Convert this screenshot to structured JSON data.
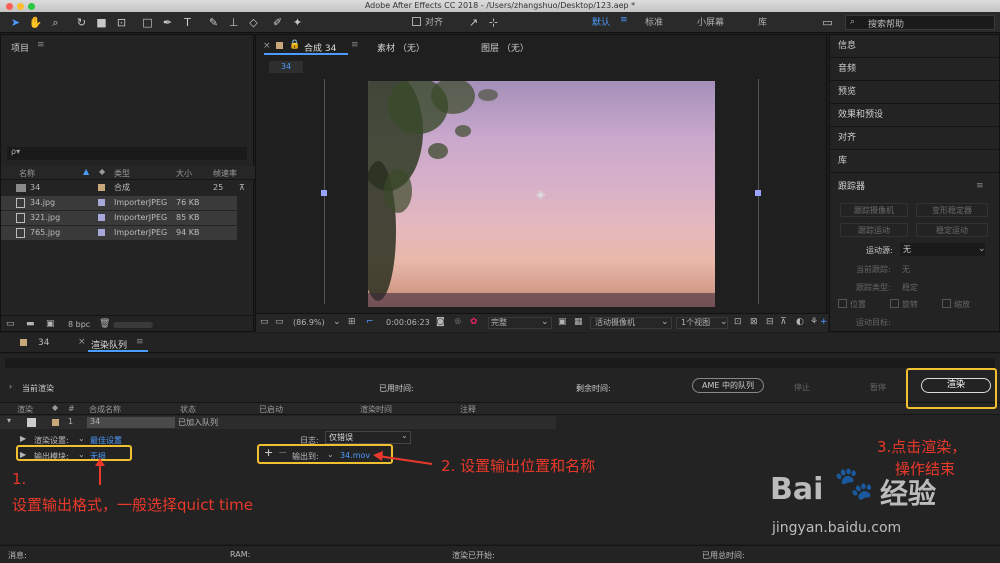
{
  "app": {
    "title": "Adobe After Effects CC 2018 - /Users/zhangshuo/Desktop/123.aep *"
  },
  "toolbar": {
    "align_label": "对齐",
    "workspaces": [
      "默认",
      "标准",
      "小屏幕",
      "库"
    ],
    "search_placeholder": "搜索帮助"
  },
  "project": {
    "title": "项目",
    "search_glyph": "ρ▾",
    "headers": {
      "name": "名称",
      "type": "类型",
      "size": "大小",
      "fps": "帧速率"
    },
    "items": [
      {
        "name": "34",
        "type": "合成",
        "size": "",
        "fps": "25"
      },
      {
        "name": "34.jpg",
        "type": "ImporterJPEG",
        "size": "76 KB",
        "fps": ""
      },
      {
        "name": "321.jpg",
        "type": "ImporterJPEG",
        "size": "85 KB",
        "fps": ""
      },
      {
        "name": "765.jpg",
        "type": "ImporterJPEG",
        "size": "94 KB",
        "fps": ""
      }
    ],
    "bpc": "8 bpc"
  },
  "comp": {
    "tab": "合成 34",
    "footage_tab": "素材 （无）",
    "layer_tab": "图层 （无）",
    "tab_chip": "34",
    "zoom": "(86.9%)",
    "timecode": "0:00:06:23",
    "quality": "完整",
    "camera": "活动摄像机",
    "views": "1个视图"
  },
  "right_panel": {
    "items": [
      "信息",
      "音频",
      "预览",
      "效果和预设",
      "对齐",
      "库"
    ],
    "tracker": {
      "title": "跟踪器",
      "buttons": [
        "跟踪摄像机",
        "变形稳定器",
        "跟踪运动",
        "稳定运动"
      ],
      "motion_source_label": "运动源:",
      "motion_source": "无",
      "current_track_label": "当前跟踪:",
      "current_track": "无",
      "track_type_label": "跟踪类型:",
      "track_type": "稳定",
      "checks": [
        "位置",
        "旋转",
        "缩放"
      ],
      "motion_target_label": "运动目标:"
    }
  },
  "bottom_tabs": {
    "comp_tab": "34",
    "render_tab": "渲染队列"
  },
  "render": {
    "current_render": "当前渲染",
    "elapsed_label": "已用时间:",
    "remaining_label": "剩余时间:",
    "ame_button": "AME 中的队列",
    "stop": "停止",
    "pause": "暂停",
    "render_button": "渲染",
    "headers": [
      "渲染",
      "#",
      "合成名称",
      "状态",
      "已启动",
      "渲染时间",
      "注释"
    ],
    "item": {
      "index": "1",
      "comp": "34",
      "status": "已加入队列"
    },
    "settings_label": "渲染设置:",
    "settings_value": "最佳设置",
    "module_label": "输出模块:",
    "module_value": "无损",
    "log_label": "日志:",
    "log_value": "仅错误",
    "output_label": "输出到:",
    "output_value": "34.mov"
  },
  "status_bar": {
    "message": "消息:",
    "ram": "RAM:",
    "started": "渲染已开始:",
    "total": "已用总时间:"
  },
  "annotations": {
    "a1_line1": "1.",
    "a1_line2": "设置输出格式，一般选择quict time",
    "a2": "2. 设置输出位置和名称",
    "a3_line1": "3.点击渲染，",
    "a3_line2": "操作结束"
  },
  "watermark": {
    "brand": "Bai",
    "brand2": "经验",
    "url": "jingyan.baidu.com"
  }
}
